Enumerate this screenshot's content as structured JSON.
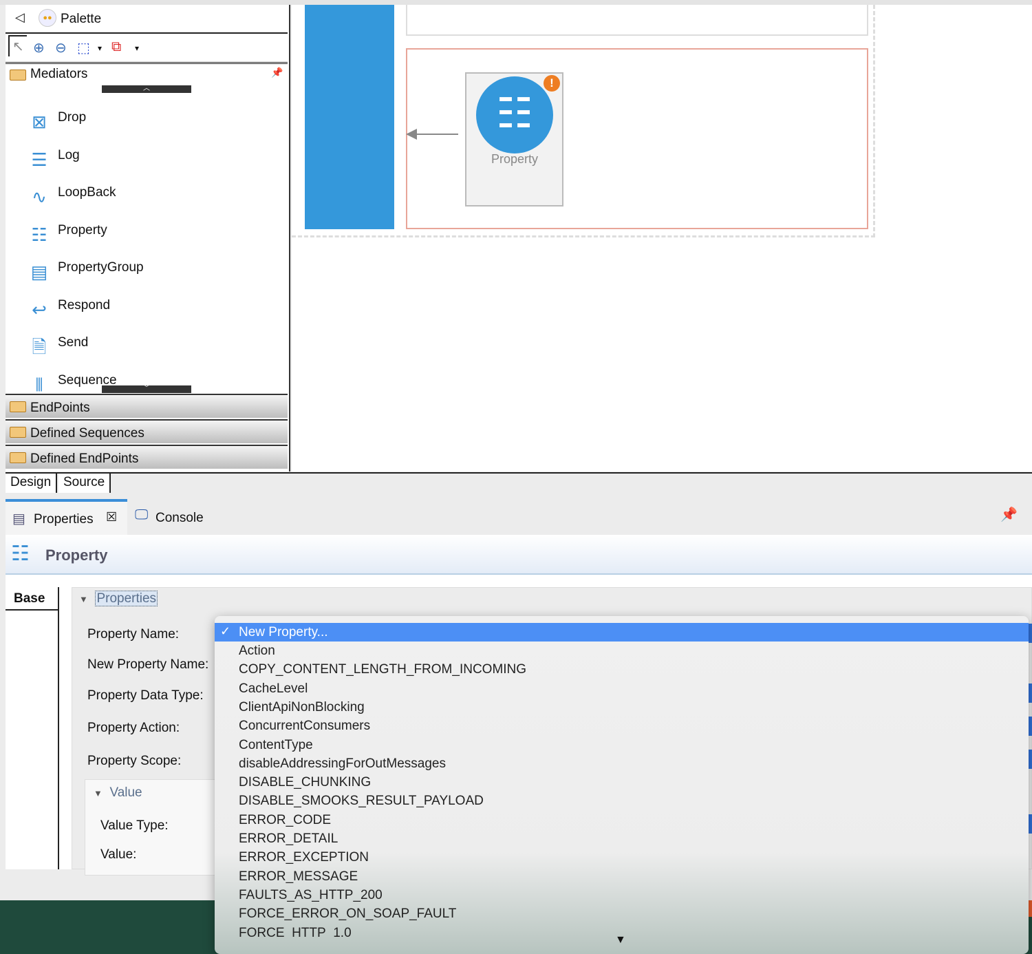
{
  "palette": {
    "title": "Palette",
    "back_icon": "triangle-left",
    "mediators_label": "Mediators",
    "items": [
      {
        "label": "Drop",
        "icon": "drop-icon"
      },
      {
        "label": "Log",
        "icon": "log-icon"
      },
      {
        "label": "LoopBack",
        "icon": "loopback-icon"
      },
      {
        "label": "Property",
        "icon": "property-icon"
      },
      {
        "label": "PropertyGroup",
        "icon": "property-group-icon"
      },
      {
        "label": "Respond",
        "icon": "respond-icon"
      },
      {
        "label": "Send",
        "icon": "send-icon"
      },
      {
        "label": "Sequence",
        "icon": "sequence-icon"
      }
    ],
    "drawers": [
      "EndPoints",
      "Defined Sequences",
      "Defined EndPoints"
    ]
  },
  "canvas": {
    "node_label": "Property",
    "accent": "#3498db",
    "warning_color": "#ee7d22"
  },
  "editor_tabs": [
    "Design",
    "Source"
  ],
  "view_tabs": {
    "properties": "Properties",
    "console": "Console"
  },
  "property_view": {
    "title": "Property",
    "base_tab": "Base",
    "section": "Properties",
    "labels": [
      "Property Name:",
      "New Property Name:",
      "Property Data Type:",
      "Property Action:",
      "Property Scope:"
    ],
    "value_section": "Value",
    "value_labels": [
      "Value Type:",
      "Value:"
    ]
  },
  "dropdown": {
    "selected": "New Property...",
    "selection_color": "#4c8ff5",
    "options": [
      "Action",
      "COPY_CONTENT_LENGTH_FROM_INCOMING",
      "CacheLevel",
      "ClientApiNonBlocking",
      "ConcurrentConsumers",
      "ContentType",
      "disableAddressingForOutMessages",
      "DISABLE_CHUNKING",
      "DISABLE_SMOOKS_RESULT_PAYLOAD",
      "ERROR_CODE",
      "ERROR_DETAIL",
      "ERROR_EXCEPTION",
      "ERROR_MESSAGE",
      "FAULTS_AS_HTTP_200",
      "FORCE_ERROR_ON_SOAP_FAULT",
      "FORCE_HTTP_1.0"
    ]
  }
}
